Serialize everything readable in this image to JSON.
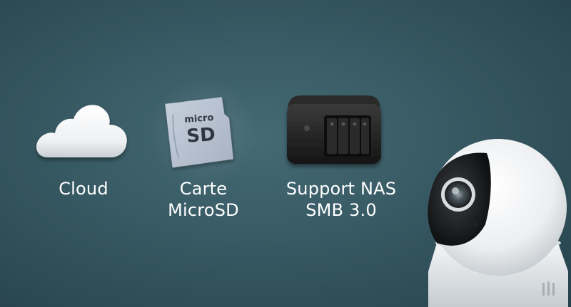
{
  "storage_options": [
    {
      "id": "cloud",
      "icon": "cloud-icon",
      "label_lines": [
        "Cloud"
      ]
    },
    {
      "id": "microsd",
      "icon": "microsd-card-icon",
      "label_lines": [
        "Carte",
        "MicroSD"
      ],
      "card_text": [
        "micro",
        "SD"
      ]
    },
    {
      "id": "nas",
      "icon": "nas-device-icon",
      "label_lines": [
        "Support NAS",
        "SMB 3.0"
      ]
    }
  ],
  "colors": {
    "background": "#2f4f58",
    "text": "#ffffff",
    "card": "#b9c3d2",
    "nas_body": "#1e1e1e",
    "camera_body": "#f2f2f2"
  }
}
